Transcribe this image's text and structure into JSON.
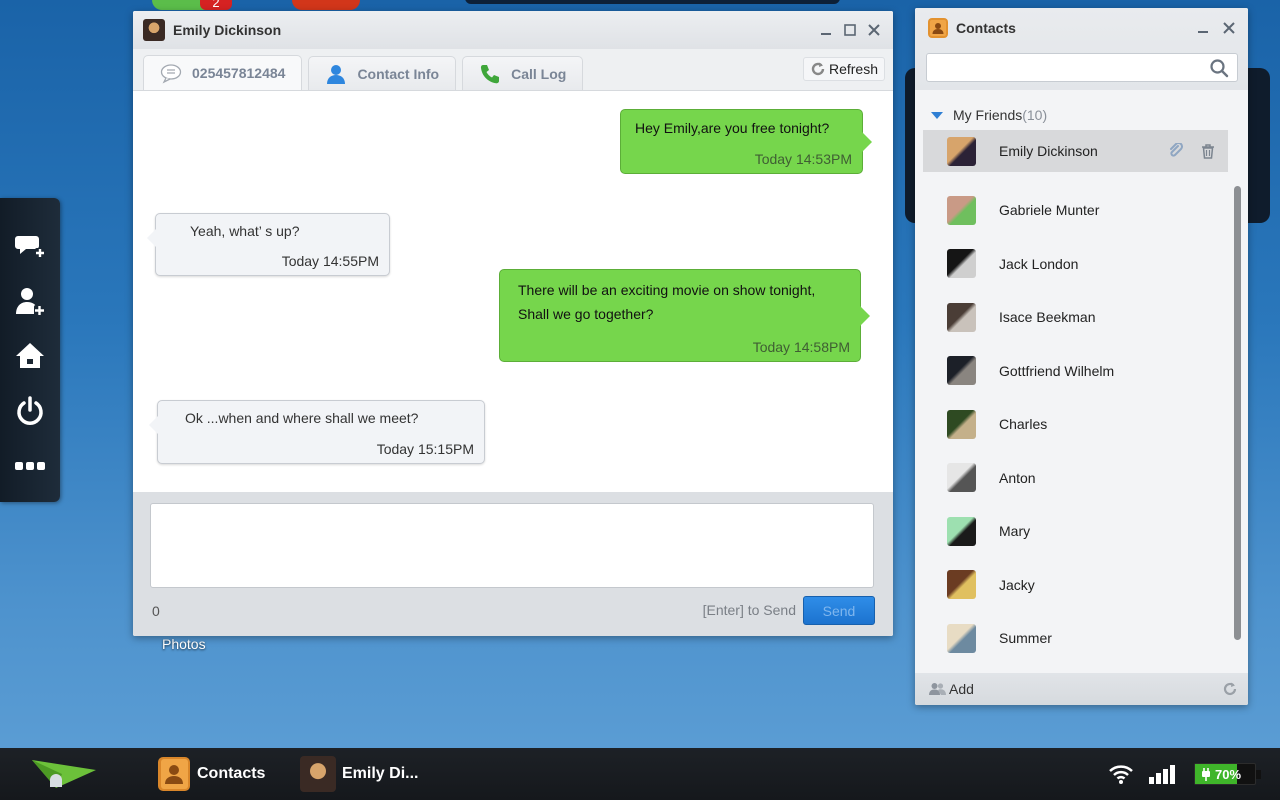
{
  "background": {
    "badge_count": "2",
    "desktop_label": "Photos"
  },
  "dock": {
    "items": [
      {
        "icon": "new-message-icon",
        "label": "New Message"
      },
      {
        "icon": "add-contact-icon",
        "label": "Add Contact"
      },
      {
        "icon": "home-icon",
        "label": "Home"
      },
      {
        "icon": "power-icon",
        "label": "Power"
      },
      {
        "icon": "more-icon",
        "label": "More"
      }
    ]
  },
  "chat_window": {
    "title": "Emily Dickinson",
    "tabs": [
      {
        "label": "025457812484",
        "icon": "message-bubble-icon",
        "active": true
      },
      {
        "label": "Contact Info",
        "icon": "person-icon",
        "active": false
      },
      {
        "label": "Call Log",
        "icon": "phone-icon",
        "active": false
      }
    ],
    "refresh_label": "Refresh",
    "messages": [
      {
        "direction": "out",
        "text": "Hey Emily,are you free tonight?",
        "time": "Today 14:53PM"
      },
      {
        "direction": "in",
        "text": "Yeah, what’ s up?",
        "time": "Today  14:55PM"
      },
      {
        "direction": "out",
        "text_lines": [
          "There will be an exciting movie on show tonight,",
          "Shall we go together?"
        ],
        "time": "Today 14:58PM"
      },
      {
        "direction": "in",
        "text": "Ok ...when and where shall we meet?",
        "time": "Today  15:15PM"
      }
    ],
    "compose": {
      "value": "",
      "placeholder": "",
      "char_count": "0",
      "enter_hint": "[Enter] to Send",
      "send_label": "Send"
    }
  },
  "contacts_window": {
    "title": "Contacts",
    "search": {
      "value": "",
      "placeholder": ""
    },
    "group": {
      "name": "My Friends",
      "count": "(10)"
    },
    "contacts": [
      {
        "name": "Emily Dickinson",
        "selected": true,
        "avatar_colors": [
          "#d7a46b",
          "#2b2236"
        ]
      },
      {
        "name": "Gabriele Munter",
        "selected": false,
        "avatar_colors": [
          "#c99a86",
          "#6fbf5e"
        ]
      },
      {
        "name": "Jack London",
        "selected": false,
        "avatar_colors": [
          "#151515",
          "#cfcfcf"
        ]
      },
      {
        "name": "Isace Beekman",
        "selected": false,
        "avatar_colors": [
          "#4a3d36",
          "#c9c2bb"
        ]
      },
      {
        "name": "Gottfriend Wilhelm",
        "selected": false,
        "avatar_colors": [
          "#1c2028",
          "#8a8580"
        ]
      },
      {
        "name": "Charles",
        "selected": false,
        "avatar_colors": [
          "#2e4a22",
          "#c4b08a"
        ]
      },
      {
        "name": "Anton",
        "selected": false,
        "avatar_colors": [
          "#e6e6e6",
          "#555555"
        ]
      },
      {
        "name": "Mary",
        "selected": false,
        "avatar_colors": [
          "#9de0b0",
          "#1a1a1a"
        ]
      },
      {
        "name": "Jacky",
        "selected": false,
        "avatar_colors": [
          "#6b3c22",
          "#e0c060"
        ]
      },
      {
        "name": "Summer",
        "selected": false,
        "avatar_colors": [
          "#e8dcc4",
          "#6d8aa0"
        ]
      }
    ],
    "footer": {
      "add_label": "Add"
    }
  },
  "taskbar": {
    "items": [
      {
        "label": "Contacts",
        "icon": "contacts-book-icon"
      },
      {
        "label": "Emily Di...",
        "icon": "emily-avatar"
      }
    ],
    "battery": {
      "percent": 70,
      "label": "70%",
      "charging": true
    },
    "wifi": "connected",
    "signal_bars": 4
  },
  "colors": {
    "outgoing_bubble": "#76d64c",
    "incoming_bubble": "#f2f4f7",
    "accent_blue": "#2f7fd4",
    "send_button": "#1c73cf",
    "battery_green": "#3fb52a"
  }
}
